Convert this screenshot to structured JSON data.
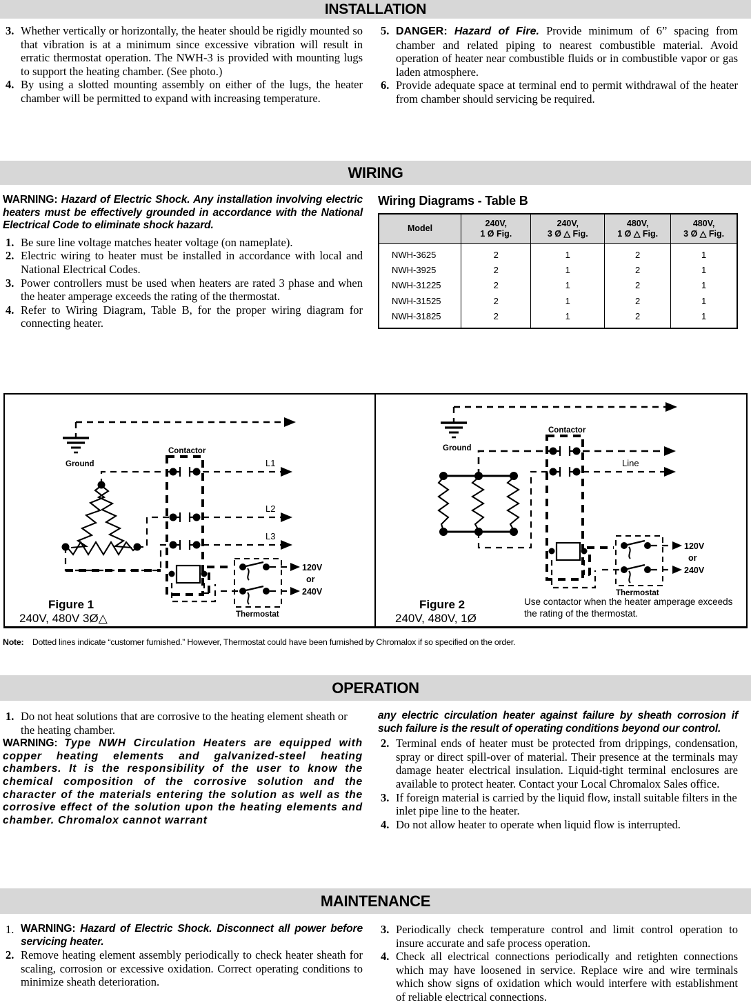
{
  "sections": {
    "installation": {
      "title": "INSTALLATION",
      "left_items": [
        {
          "num": "3.",
          "text": "Whether vertically or horizontally, the heater should be rigidly mounted so that vibration is at a minimum since excessive vibration will result in erratic thermostat operation. The NWH-3 is provided with mounting lugs to support the heating chamber. (See photo.)"
        },
        {
          "num": "4.",
          "text": "By using a slotted mounting assembly on either of the lugs, the heater chamber will be permitted to expand with increasing temperature."
        }
      ],
      "right_items": [
        {
          "num": "5.",
          "lead": "DANGER:",
          "lead_italic": "Hazard of Fire.",
          "text": "Provide minimum of 6” spacing from chamber and related piping to nearest combustible material. Avoid operation of heater near combustible fluids or in combustible vapor or gas laden atmosphere."
        },
        {
          "num": "6.",
          "text": "Provide adequate space at terminal end to permit withdrawal of the heater from chamber should servicing be required."
        }
      ]
    },
    "wiring": {
      "title": "WIRING",
      "warning_lead": "WARNING:",
      "warning_italic": "Hazard of Electric Shock. Any installation involving electric heaters must be effectively grounded in accordance with the National Electrical Code to eliminate shock hazard.",
      "items": [
        {
          "num": "1.",
          "text": "Be sure line voltage matches heater voltage (on nameplate)."
        },
        {
          "num": "2.",
          "text": "Electric wiring to heater must be installed in accordance with local and National Electrical Codes."
        },
        {
          "num": "3.",
          "text": "Power controllers must be used when heaters are rated 3 phase and when the heater amperage exceeds the rating of the thermostat."
        },
        {
          "num": "4.",
          "text": "Refer to Wiring Diagram, Table B, for the proper wiring diagram for connecting heater."
        }
      ],
      "table_title": "Wiring Diagrams - Table B",
      "table": {
        "headers": [
          {
            "line1": "Model",
            "line2": ""
          },
          {
            "line1": "240V,",
            "line2": "1 Ø   Fig."
          },
          {
            "line1": "240V,",
            "line2": "3 Ø △ Fig."
          },
          {
            "line1": "480V,",
            "line2": "1 Ø △ Fig."
          },
          {
            "line1": "480V,",
            "line2": "3 Ø △ Fig."
          }
        ],
        "rows": [
          [
            "NWH-3625",
            "2",
            "1",
            "2",
            "1"
          ],
          [
            "NWH-3925",
            "2",
            "1",
            "2",
            "1"
          ],
          [
            "NWH-31225",
            "2",
            "1",
            "2",
            "1"
          ],
          [
            "NWH-31525",
            "2",
            "1",
            "2",
            "1"
          ],
          [
            "NWH-31825",
            "2",
            "1",
            "2",
            "1"
          ]
        ]
      }
    },
    "diagrams": {
      "figure1": {
        "caption_title": "Figure 1",
        "caption_sub": "240V, 480V 3Ø△",
        "labels": {
          "ground": "Ground",
          "contactor": "Contactor",
          "thermostat": "Thermostat",
          "l1": "L1",
          "l2": "L2",
          "l3": "L3",
          "v120": "120V",
          "or": "or",
          "v240": "240V"
        }
      },
      "figure2": {
        "caption_title": "Figure 2",
        "caption_sub": "240V, 480V, 1Ø",
        "note": "Use contactor when the heater amperage exceeds the rating of the thermostat.",
        "labels": {
          "ground": "Ground",
          "contactor": "Contactor",
          "thermostat": "Thermostat",
          "line": "Line",
          "v120": "120V",
          "or": "or",
          "v240": "240V"
        }
      },
      "note_label": "Note:",
      "note_text": "Dotted lines indicate “customer furnished.” However, Thermostat could have been furnished by Chromalox if so specified on the order."
    },
    "operation": {
      "title": "OPERATION",
      "item1": {
        "num": "1.",
        "text": "Do not heat solutions that are corrosive to the heating element sheath or the heating chamber."
      },
      "warning_lead": "WARNING:",
      "warning_italic_left": "Type NWH Circulation Heaters are equipped with copper heating elements and galvanized-steel heating chambers. It is the responsibility of the user to know the chemical composition of the corrosive solution and the character of the materials entering the solution as well as the corrosive effect of the solution upon the heating elements and chamber. Chromalox cannot warrant",
      "warning_italic_right": "any electric circulation heater against failure by sheath corrosion if such failure is the result of operating conditions beyond our control.",
      "right_items": [
        {
          "num": "2.",
          "text": "Terminal ends of heater must be protected from drippings, condensation, spray or direct spill-over of material. Their presence at the terminals may damage heater electrical insulation. Liquid-tight terminal enclosures are available to protect heater. Contact your Local Chromalox Sales office."
        },
        {
          "num": "3.",
          "text": "If foreign material is carried by the liquid flow, install suitable filters in the inlet pipe line to the heater."
        },
        {
          "num": "4.",
          "text": "Do not allow heater to operate when liquid flow is interrupted."
        }
      ]
    },
    "maintenance": {
      "title": "MAINTENANCE",
      "left_items": [
        {
          "num": "1.",
          "lead": "WARNING:",
          "lead_italic": "Hazard of Electric Shock. Disconnect all power before servicing heater.",
          "is_warning": true
        },
        {
          "num": "2.",
          "text": "Remove heating element assembly periodically to check heater sheath for scaling, corrosion or excessive oxidation. Correct operating conditions to minimize sheath deterioration."
        }
      ],
      "right_items": [
        {
          "num": "3.",
          "text": "Periodically check temperature control and limit control operation to insure accurate and safe process operation."
        },
        {
          "num": "4.",
          "text": "Check all electrical connections periodically and retighten connections which may have loosened in service. Replace wire and wire terminals which show signs of oxidation which would interfere with establishment of reliable electrical connections."
        }
      ]
    }
  },
  "colors": {
    "band_bg": "#d7d7d7",
    "text": "#000000",
    "page_bg": "#ffffff"
  }
}
